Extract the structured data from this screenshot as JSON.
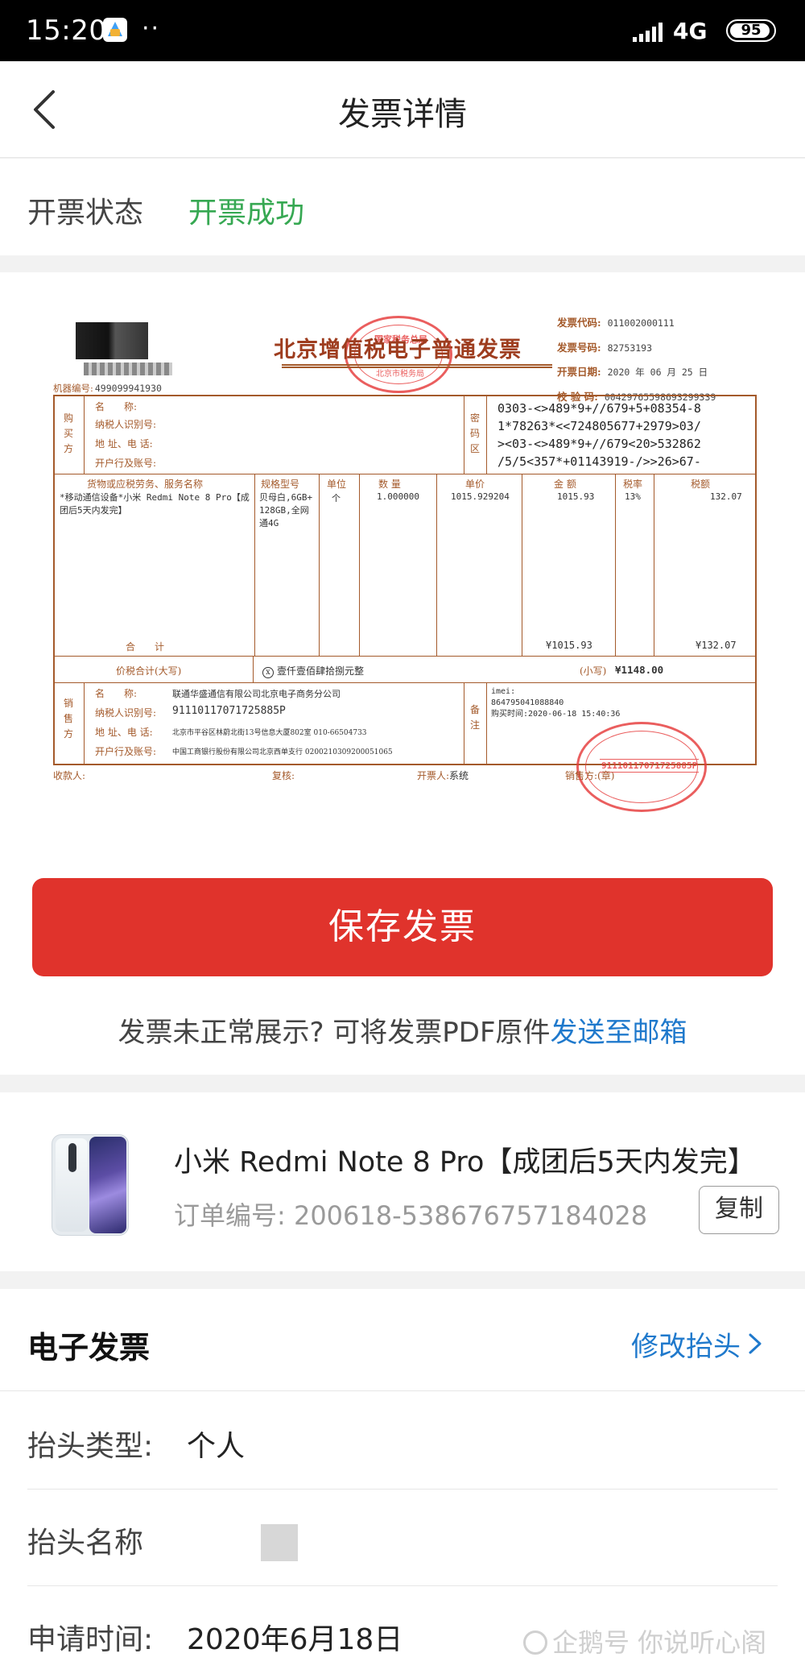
{
  "status_bar": {
    "time": "15:20",
    "dots": "··",
    "network": "4G",
    "battery": "95",
    "battery_level": 0.95
  },
  "nav": {
    "title": "发票详情",
    "back_icon": "chevron-left-icon"
  },
  "invoice_status": {
    "label": "开票状态",
    "value": "开票成功",
    "value_color": "#36a852"
  },
  "invoice_image": {
    "title": "北京增值税电子普通发票",
    "seal_top_line1": "国家税务总局",
    "seal_top_line2": "北京市税务局",
    "meta": [
      {
        "key": "发票代码:",
        "value": "011002000111"
      },
      {
        "key": "发票号码:",
        "value": "82753193"
      },
      {
        "key": "开票日期:",
        "value": "2020 年 06 月 25 日"
      },
      {
        "key": "校 验 码:",
        "value": "00429765598693299339"
      }
    ],
    "machine_label": "机器编号:",
    "machine_no": "499099941930",
    "buyer_side": "购买方",
    "buyer_fields": [
      "名　　称:",
      "纳税人识别号:",
      "地 址、电 话:",
      "开户行及账号:"
    ],
    "cipher_side": "密码区",
    "cipher": "0303-<>489*9+//679+5+08354-8\n1*78263*<<724805677+2979>03/\n><03-<>489*9+//679<20>532862\n/5/5<357*+01143919-/>>26>67-",
    "columns": [
      "货物或应税劳务、服务名称",
      "规格型号",
      "单位",
      "数 量",
      "单价",
      "金 额",
      "税率",
      "税额"
    ],
    "item": {
      "name": "*移动通信设备*小米 Redmi Note 8 Pro【成团后5天内发完】",
      "spec": "贝母白,6GB+128GB,全网通4G",
      "unit": "个",
      "qty": "1.000000",
      "price": "1015.929204",
      "amount": "1015.93",
      "rate": "13%",
      "tax": "132.07"
    },
    "total_label": "合　　计",
    "total_amount": "¥1015.93",
    "total_tax": "¥132.07",
    "grand_label": "价税合计(大写)",
    "grand_upper": "壹仟壹佰肆拾捌元整",
    "grand_small_label": "(小写)",
    "grand_small": "¥1148.00",
    "seller_side": "销售方",
    "seller": [
      {
        "key": "名　　称:",
        "value": "联通华盛通信有限公司北京电子商务分公司"
      },
      {
        "key": "纳税人识别号:",
        "value": "91110117071725885P"
      },
      {
        "key": "地 址、电 话:",
        "value": "北京市平谷区林蔚北街13号信息大厦802室 010-66504733"
      },
      {
        "key": "开户行及账号:",
        "value": "中国工商银行股份有限公司北京西单支行 0200210309200051065"
      }
    ],
    "remark_side": "备注",
    "remark": "imei:\n864795041088840\n购买时间:2020-06-18 15:40:36",
    "seal_bottom_text": "91110117071725885P",
    "payee_label": "收款人:",
    "reviewer_label": "复核:",
    "drawer_label": "开票人:",
    "drawer_value": "系统",
    "seller_sign_label": "销售方:(章)"
  },
  "save_button": {
    "label": "保存发票"
  },
  "hint": {
    "text": "发票未正常展示? 可将发票PDF原件",
    "link": "发送至邮箱"
  },
  "product": {
    "name": "小米 Redmi Note 8 Pro【成团后5天内发完】",
    "order_no": "订单编号: 200618-538676757184028",
    "copy_label": "复制"
  },
  "einvoice": {
    "title": "电子发票",
    "edit_label": "修改抬头",
    "fields": [
      {
        "label": "抬头类型:",
        "value": "个人"
      },
      {
        "label": "抬头名称",
        "value": ""
      },
      {
        "label": "申请时间:",
        "value": "2020年6月18日"
      }
    ]
  },
  "watermark": {
    "text": "企鹅号 你说听心阁"
  },
  "colors": {
    "accent_red": "#e0332c",
    "link_blue": "#1f79cc",
    "success_green": "#36a852",
    "invoice_brown": "#a45a2b",
    "seal_red": "#e63b3b"
  }
}
